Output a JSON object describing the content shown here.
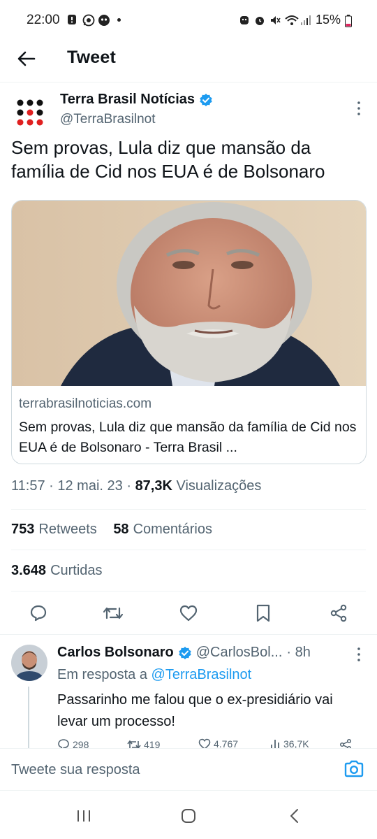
{
  "status_bar": {
    "time": "22:00",
    "battery": "15%",
    "left_icons": [
      "alert-icon",
      "whatsapp-icon",
      "app-icon"
    ],
    "right_icons": [
      "face-icon",
      "alarm-icon",
      "mute-icon",
      "wifi-icon",
      "signal-icon",
      "battery-icon"
    ]
  },
  "header": {
    "title": "Tweet"
  },
  "author": {
    "name": "Terra Brasil Notícias",
    "handle": "@TerraBrasilnot",
    "verified": true
  },
  "tweet": {
    "text": "Sem provas, Lula diz que mansão da família de Cid nos EUA é de Bolsonaro"
  },
  "card": {
    "domain": "terrabrasilnoticias.com",
    "title": "Sem provas, Lula diz que mansão da família de Cid nos EUA é de Bolsonaro - Terra Brasil ..."
  },
  "meta": {
    "time": "11:57",
    "separator": "·",
    "date": "12 mai. 23",
    "views_count": "87,3K",
    "views_label": "Visualizações"
  },
  "stats": {
    "retweets_count": "753",
    "retweets_label": "Retweets",
    "comments_count": "58",
    "comments_label": "Comentários",
    "likes_count": "3.648",
    "likes_label": "Curtidas"
  },
  "reply": {
    "name": "Carlos Bolsonaro",
    "handle": "@CarlosBol...",
    "time": "· 8h",
    "in_reply_prefix": "Em resposta a",
    "in_reply_mention": "@TerraBrasilnot",
    "text": "Passarinho me falou que o ex-presidiário vai levar um processo!",
    "counts": {
      "replies": "298",
      "retweets": "419",
      "likes": "4.767",
      "views": "36,7K"
    }
  },
  "compose": {
    "placeholder": "Tweete sua resposta"
  },
  "colors": {
    "accent": "#1d9bf0",
    "text": "#0f1419",
    "secondary": "#536471",
    "border": "#cfd9de"
  }
}
